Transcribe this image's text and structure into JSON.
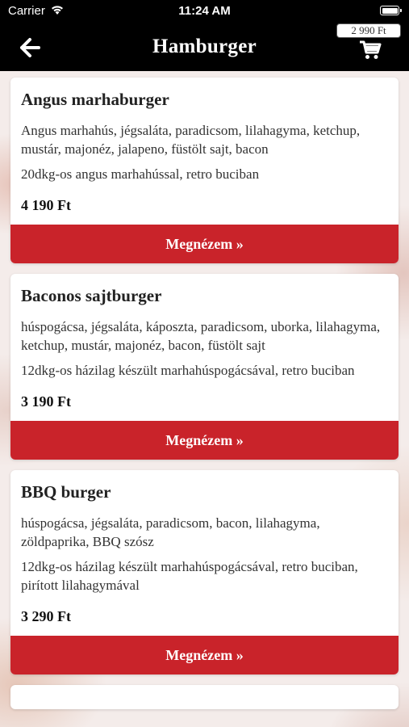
{
  "status_bar": {
    "carrier": "Carrier",
    "time": "11:24 AM"
  },
  "nav": {
    "title": "Hamburger",
    "cart_total": "2 990 Ft"
  },
  "products": [
    {
      "name": "Angus marhaburger",
      "description": "Angus marhahús, jégsaláta, paradicsom, lilahagyma, ketchup, mustár, majonéz, jalapeno, füstölt sajt, bacon",
      "extra": "20dkg-os angus marhahússal, retro buciban",
      "price": "4 190 Ft",
      "button": "Megnézem »"
    },
    {
      "name": "Baconos sajtburger",
      "description": "húspogácsa, jégsaláta, káposzta, paradicsom, uborka, lilahagyma, ketchup, mustár, majonéz, bacon, füstölt sajt",
      "extra": "12dkg-os házilag készült marhahúspogácsával, retro buciban",
      "price": "3 190 Ft",
      "button": "Megnézem »"
    },
    {
      "name": "BBQ burger",
      "description": "húspogácsa, jégsaláta, paradicsom, bacon, lilahagyma, zöldpaprika, BBQ szósz",
      "extra": "12dkg-os házilag készült marhahúspogácsával, retro buciban, pirított lilahagymával",
      "price": "3 290 Ft",
      "button": "Megnézem »"
    }
  ],
  "partial_card": {
    "name": ""
  },
  "colors": {
    "accent": "#c9232a",
    "bar": "#000000"
  },
  "icons": {
    "back": "arrow-left-icon",
    "cart": "shopping-cart-icon",
    "wifi": "wifi-icon",
    "battery": "battery-icon"
  }
}
